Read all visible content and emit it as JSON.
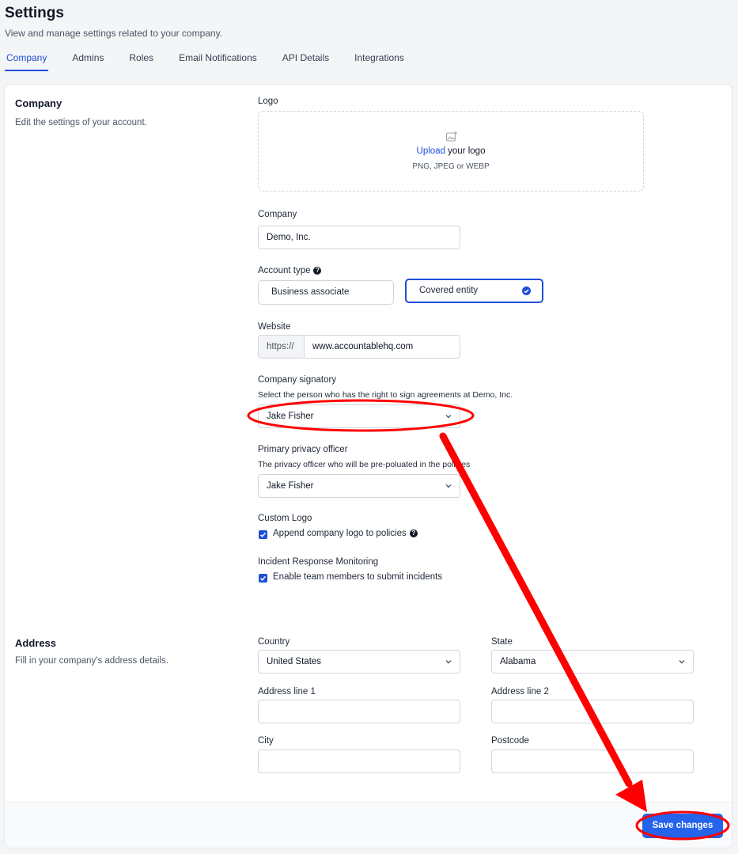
{
  "header": {
    "title": "Settings",
    "subtitle": "View and manage settings related to your company."
  },
  "tabs": [
    {
      "label": "Company",
      "active": true
    },
    {
      "label": "Admins",
      "active": false
    },
    {
      "label": "Roles",
      "active": false
    },
    {
      "label": "Email Notifications",
      "active": false
    },
    {
      "label": "API Details",
      "active": false
    },
    {
      "label": "Integrations",
      "active": false
    }
  ],
  "company_section": {
    "title": "Company",
    "description": "Edit the settings of your account."
  },
  "logo": {
    "label": "Logo",
    "upload_link": "Upload",
    "upload_text": " your logo",
    "hint": "PNG, JPEG or WEBP"
  },
  "company": {
    "label": "Company",
    "value": "Demo, Inc."
  },
  "account_type": {
    "label": "Account type",
    "options": [
      {
        "label": "Business associate",
        "selected": false
      },
      {
        "label": "Covered entity",
        "selected": true
      }
    ]
  },
  "website": {
    "label": "Website",
    "prefix": "https://",
    "value": "www.accountablehq.com"
  },
  "signatory": {
    "label": "Company signatory",
    "description": "Select the person who has the right to sign agreements at Demo, Inc.",
    "value": "Jake Fisher"
  },
  "privacy_officer": {
    "label": "Primary privacy officer",
    "description": "The privacy officer who will be pre-poluated in the policies",
    "value": "Jake Fisher"
  },
  "custom_logo": {
    "label": "Custom Logo",
    "checkbox_label": "Append company logo to policies",
    "checked": true
  },
  "incident_monitoring": {
    "label": "Incident Response Monitoring",
    "checkbox_label": "Enable team members to submit incidents",
    "checked": true
  },
  "address_section": {
    "title": "Address",
    "description": "Fill in your company's address details."
  },
  "address": {
    "country_label": "Country",
    "country_value": "United States",
    "state_label": "State",
    "state_value": "Alabama",
    "line1_label": "Address line 1",
    "line1_value": "",
    "line2_label": "Address line 2",
    "line2_value": "",
    "city_label": "City",
    "city_value": "",
    "postcode_label": "Postcode",
    "postcode_value": ""
  },
  "footer": {
    "save_label": "Save changes"
  },
  "colors": {
    "accent": "#1d4ed8",
    "primary_button": "#2563eb",
    "annotation": "#ff0000"
  },
  "icons": {
    "upload": "image-icon",
    "help": "question-circle-icon",
    "select": "chevron-down-icon",
    "selected": "check-circle-icon"
  }
}
